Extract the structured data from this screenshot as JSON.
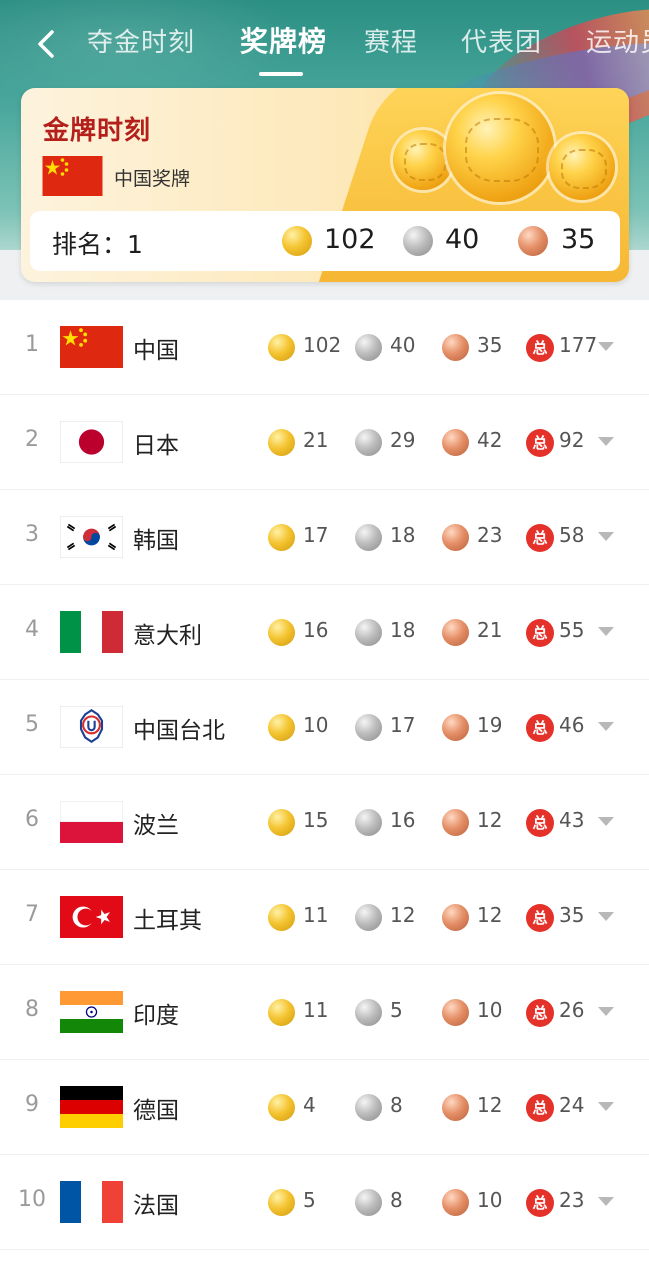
{
  "nav": {
    "back_icon": "chevron-left-icon",
    "tabs": [
      {
        "label": "夺金时刻",
        "active": false
      },
      {
        "label": "奖牌榜",
        "active": true
      },
      {
        "label": "赛程",
        "active": false
      },
      {
        "label": "代表团",
        "active": false
      },
      {
        "label": "运动员",
        "active": false
      }
    ]
  },
  "summary": {
    "title": "金牌时刻",
    "subtitle": "中国奖牌",
    "rank_label": "排名：1",
    "gold": "102",
    "silver": "40",
    "bronze": "35"
  },
  "total_badge": "总",
  "colors": {
    "header_teal": "#2b8f83",
    "title_red": "#b41f1b",
    "total_red": "#e4322b",
    "gold": "#f4c431",
    "silver": "#bdbdbd",
    "bronze": "#e59068"
  },
  "rows": [
    {
      "rank": "1",
      "flag": "china-flag",
      "name": "中国",
      "gold": "102",
      "silver": "40",
      "bronze": "35",
      "total": "177"
    },
    {
      "rank": "2",
      "flag": "japan-flag",
      "name": "日本",
      "gold": "21",
      "silver": "29",
      "bronze": "42",
      "total": "92"
    },
    {
      "rank": "3",
      "flag": "korea-flag",
      "name": "韩国",
      "gold": "17",
      "silver": "18",
      "bronze": "23",
      "total": "58"
    },
    {
      "rank": "4",
      "flag": "italy-flag",
      "name": "意大利",
      "gold": "16",
      "silver": "18",
      "bronze": "21",
      "total": "55"
    },
    {
      "rank": "5",
      "flag": "chinese-taipei-flag",
      "name": "中国台北",
      "gold": "10",
      "silver": "17",
      "bronze": "19",
      "total": "46"
    },
    {
      "rank": "6",
      "flag": "poland-flag",
      "name": "波兰",
      "gold": "15",
      "silver": "16",
      "bronze": "12",
      "total": "43"
    },
    {
      "rank": "7",
      "flag": "turkey-flag",
      "name": "土耳其",
      "gold": "11",
      "silver": "12",
      "bronze": "12",
      "total": "35"
    },
    {
      "rank": "8",
      "flag": "india-flag",
      "name": "印度",
      "gold": "11",
      "silver": "5",
      "bronze": "10",
      "total": "26"
    },
    {
      "rank": "9",
      "flag": "germany-flag",
      "name": "德国",
      "gold": "4",
      "silver": "8",
      "bronze": "12",
      "total": "24"
    },
    {
      "rank": "10",
      "flag": "france-flag",
      "name": "法国",
      "gold": "5",
      "silver": "8",
      "bronze": "10",
      "total": "23"
    }
  ]
}
